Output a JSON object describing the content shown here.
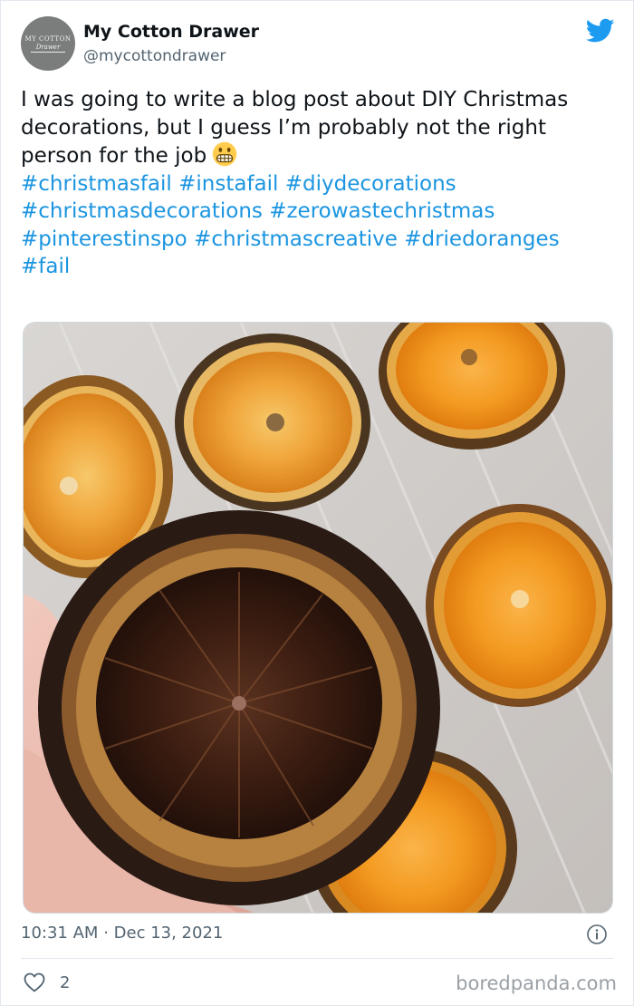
{
  "account": {
    "display_name": "My Cotton Drawer",
    "handle": "@mycottondrawer",
    "avatar_logo_top": "MY COTTON",
    "avatar_logo_bottom": "Drawer"
  },
  "tweet": {
    "text": "I was going to write a blog post about DIY Christmas decorations, but I guess I’m probably not the right person for the job",
    "emoji": "grimacing-face-emoji",
    "hashtags": [
      "#christmasfail",
      "#instafail",
      "#diydecorations",
      "#christmasdecorations",
      "#zerowastechristmas",
      "#pinterestinspo",
      "#christmascreative",
      "#driedoranges",
      "#fail"
    ],
    "time": "10:31 AM",
    "separator": "·",
    "date": "Dec 13, 2021",
    "likes": "2"
  },
  "photo": {
    "subject": "burnt dried orange slice held in fingers above dried orange slices on baking paper"
  },
  "watermark": "boredpanda.com",
  "colors": {
    "brand_blue": "#1d9bf0",
    "hashtag": "#1b95e0",
    "muted_text": "#536471"
  },
  "icons": [
    "twitter-bird-icon",
    "info-icon",
    "heart-icon"
  ]
}
